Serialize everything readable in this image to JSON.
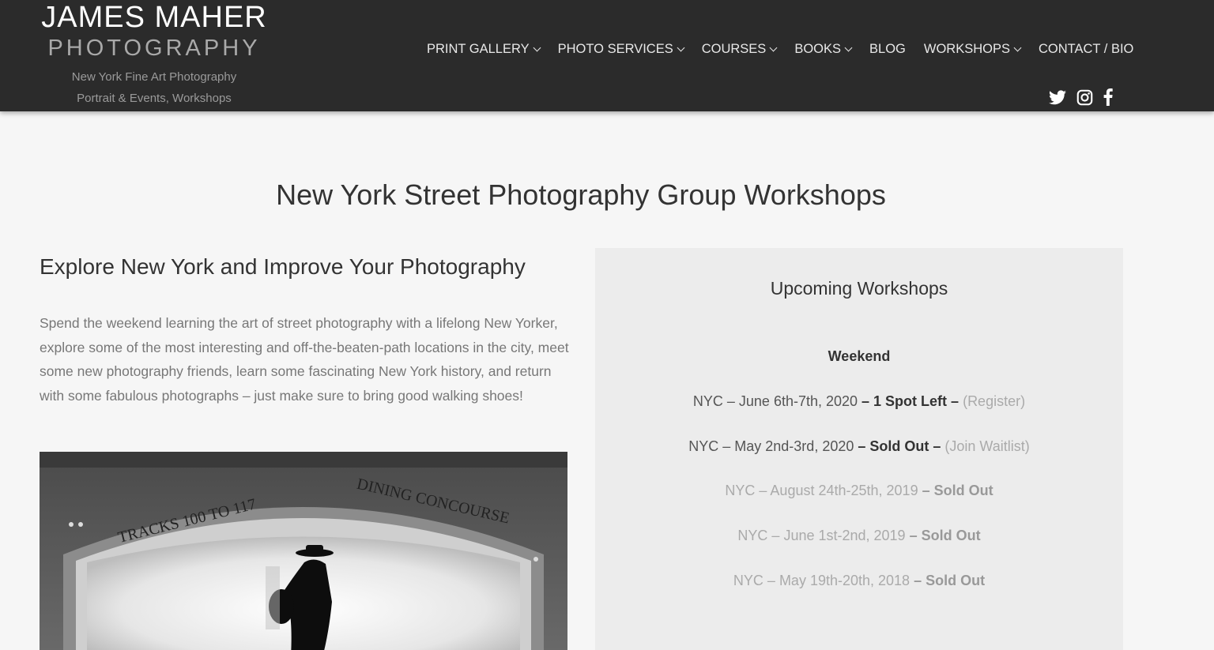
{
  "logo": {
    "name_line1": "JAMES MAHER",
    "name_line2": "PHOTOGRAPHY",
    "tagline1": "New York Fine Art Photography",
    "tagline2": "Portrait & Events, Workshops"
  },
  "nav": {
    "items": [
      {
        "label": "PRINT GALLERY"
      },
      {
        "label": "PHOTO SERVICES"
      },
      {
        "label": "COURSES"
      },
      {
        "label": "BOOKS"
      },
      {
        "label": "BLOG"
      },
      {
        "label": "WORKSHOPS"
      },
      {
        "label": "CONTACT / BIO"
      }
    ]
  },
  "social": {
    "icons": [
      "twitter-icon",
      "instagram-icon",
      "facebook-icon"
    ]
  },
  "page": {
    "title": "New York Street Photography Group Workshops"
  },
  "intro": {
    "heading": "Explore New York and Improve Your Photography",
    "body": "Spend the weekend learning the art of street photography with a lifelong New Yorker, explore some of the most interesting and off-the-beaten-path locations in the city, meet some new photography friends, learn some fascinating New York history, and return with some fabulous photographs – just make sure to bring good walking shoes!"
  },
  "photo": {
    "sign_left": "TRACKS 100 TO 117",
    "sign_right": "DINING CONCOURSE"
  },
  "workshops": {
    "heading": "Upcoming Workshops",
    "subheading": "Weekend",
    "list": [
      {
        "date": "NYC – June 6th-7th, 2020",
        "status": " – 1 Spot Left – ",
        "link": "Register"
      },
      {
        "date": "NYC – May 2nd-3rd, 2020",
        "status": " – Sold Out – ",
        "link": "Join Waitlist"
      },
      {
        "date": "NYC – August 24th-25th, 2019",
        "status": " – Sold Out"
      },
      {
        "date": "NYC – June 1st-2nd, 2019",
        "status": " – Sold Out"
      },
      {
        "date": "NYC – May 19th-20th, 2018",
        "status": " – Sold Out"
      }
    ]
  },
  "colors": {
    "header_bg": "#2b2b2b",
    "page_bg": "#f6f6f6",
    "panel_bg": "#ececec"
  }
}
